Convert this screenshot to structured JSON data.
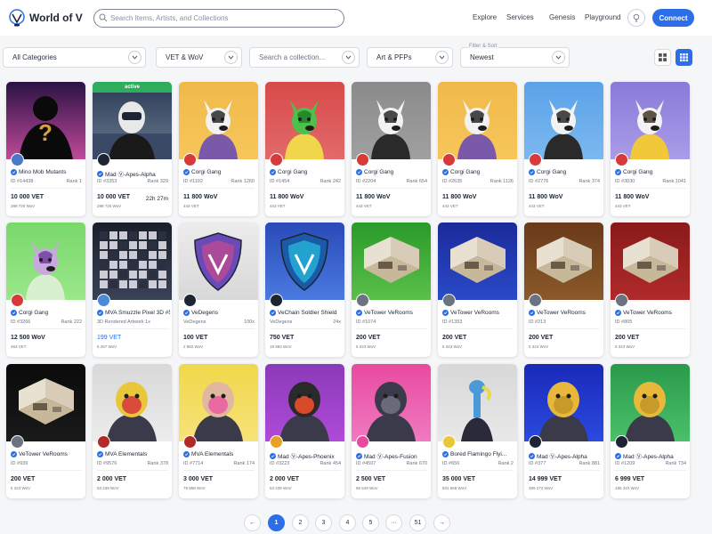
{
  "header": {
    "brand": "World of V",
    "search_placeholder": "Search Items, Artists, and Collections",
    "nav": [
      "Explore",
      "Services",
      "Genesis",
      "Playground"
    ],
    "connect_label": "Connect"
  },
  "filters": {
    "category": "All Categories",
    "currency": "VET & WoV",
    "collection_placeholder": "Search a collection...",
    "type": "Art & PFPs",
    "sort_label": "Filter & Sort",
    "sort_value": "Newest"
  },
  "cards": [
    {
      "name": "Mino Mob Mutants",
      "id": "ID #14438",
      "rank": "Rank 1",
      "price": "10 000 VET",
      "sub": "288 720 WoV"
    },
    {
      "name": "Mad Ⓥ-Apes-Alpha",
      "id": "ID #3353",
      "rank": "Rank 329",
      "price": "10 000 VET",
      "sub": "288 720 WoV",
      "badge": "active",
      "timer": "22h 27m"
    },
    {
      "name": "Corgi Gang",
      "id": "ID #1192",
      "rank": "Rank 1260",
      "price": "11 800 WoV",
      "sub": "443 VET"
    },
    {
      "name": "Corgi Gang",
      "id": "ID #1454",
      "rank": "Rank 242",
      "price": "11 800 WoV",
      "sub": "443 VET"
    },
    {
      "name": "Corgi Gang",
      "id": "ID #2204",
      "rank": "Rank 654",
      "price": "11 800 WoV",
      "sub": "443 VET"
    },
    {
      "name": "Corgi Gang",
      "id": "ID #2635",
      "rank": "Rank 1126",
      "price": "11 800 WoV",
      "sub": "443 VET"
    },
    {
      "name": "Corgi Gang",
      "id": "ID #2776",
      "rank": "Rank 374",
      "price": "11 800 WoV",
      "sub": "443 VET"
    },
    {
      "name": "Corgi Gang",
      "id": "ID #3030",
      "rank": "Rank 1041",
      "price": "11 800 WoV",
      "sub": "443 VET"
    },
    {
      "name": "Corgi Gang",
      "id": "ID #3266",
      "rank": "Rank 222",
      "price": "12 500 WoV",
      "sub": "463 VET"
    },
    {
      "name": "MVA Smuzzle Pixel 3D #5",
      "id": "3D Rendered Artwork 1x",
      "rank": "",
      "price": "199 VET",
      "sub": "5 257 WoV"
    },
    {
      "name": "VeDegens",
      "id": "VeDegens",
      "rank": "100x",
      "price": "100 VET",
      "sub": "2 882 WoV"
    },
    {
      "name": "VeChain Soldier Shield",
      "id": "VeDegens",
      "rank": "24x",
      "price": "750 VET",
      "sub": "19 994 WoV"
    },
    {
      "name": "VeTower VeRooms",
      "id": "ID #1074",
      "rank": "",
      "price": "200 VET",
      "sub": "5 323 WoV"
    },
    {
      "name": "VeTower VeRooms",
      "id": "ID #1353",
      "rank": "",
      "price": "200 VET",
      "sub": "5 323 WoV"
    },
    {
      "name": "VeTower VeRooms",
      "id": "ID #213",
      "rank": "",
      "price": "200 VET",
      "sub": "5 323 WoV"
    },
    {
      "name": "VeTower VeRooms",
      "id": "ID #805",
      "rank": "",
      "price": "200 VET",
      "sub": "5 323 WoV"
    },
    {
      "name": "VeTower VeRooms",
      "id": "ID #939",
      "rank": "",
      "price": "200 VET",
      "sub": "5 323 WoV"
    },
    {
      "name": "MVA Elementals",
      "id": "ID #9576",
      "rank": "Rank 378",
      "price": "2 000 VET",
      "sub": "53 239 WoV"
    },
    {
      "name": "MVA Elementals",
      "id": "ID #7714",
      "rank": "Rank 174",
      "price": "3 000 VET",
      "sub": "79 858 WoV"
    },
    {
      "name": "Mad Ⓥ-Apes-Phoenix",
      "id": "ID #3223",
      "rank": "Rank 454",
      "price": "2 000 VET",
      "sub": "53 239 WoV"
    },
    {
      "name": "Mad Ⓥ-Apes-Fusion",
      "id": "ID #4507",
      "rank": "Rank 670",
      "price": "2 500 VET",
      "sub": "66 549 WoV"
    },
    {
      "name": "Bored Flamingo Flyi...",
      "id": "ID #656",
      "rank": "Rank 2",
      "price": "35 000 VET",
      "sub": "931 668 WoV"
    },
    {
      "name": "Mad Ⓥ-Apes-Alpha",
      "id": "ID #377",
      "rank": "Rank 881",
      "price": "14 999 VET",
      "sub": "399 272 WoV"
    },
    {
      "name": "Mad Ⓥ-Apes-Alpha",
      "id": "ID #1209",
      "rank": "Rank 734",
      "price": "6 999 VET",
      "sub": "186 310 WoV"
    }
  ],
  "pagination": [
    "←",
    "1",
    "2",
    "3",
    "4",
    "5",
    "···",
    "51",
    "→"
  ]
}
